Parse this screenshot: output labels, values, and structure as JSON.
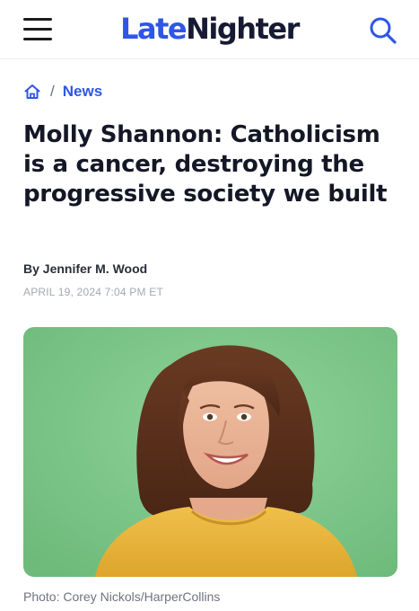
{
  "header": {
    "logo_part1": "Late",
    "logo_part2": "Nighter",
    "menu_icon": "hamburger-menu-icon",
    "search_icon": "search-icon"
  },
  "breadcrumb": {
    "home_icon": "home-icon",
    "separator": "/",
    "section": "News"
  },
  "article": {
    "headline": "Molly Shannon: Catholicism is a cancer, destroying the progressive society we built",
    "byline_prefix": "By",
    "author": "Jennifer M. Wood",
    "date": "APRIL 19, 2024 7:04 PM ET",
    "photo_caption": "Photo: Corey Nickols/HarperCollins"
  },
  "colors": {
    "brand_blue": "#2f56e6",
    "logo_dark": "#161a33",
    "headline": "#141826",
    "photo_background": "#7fc78a",
    "sweater_yellow": "#e8b53a"
  }
}
